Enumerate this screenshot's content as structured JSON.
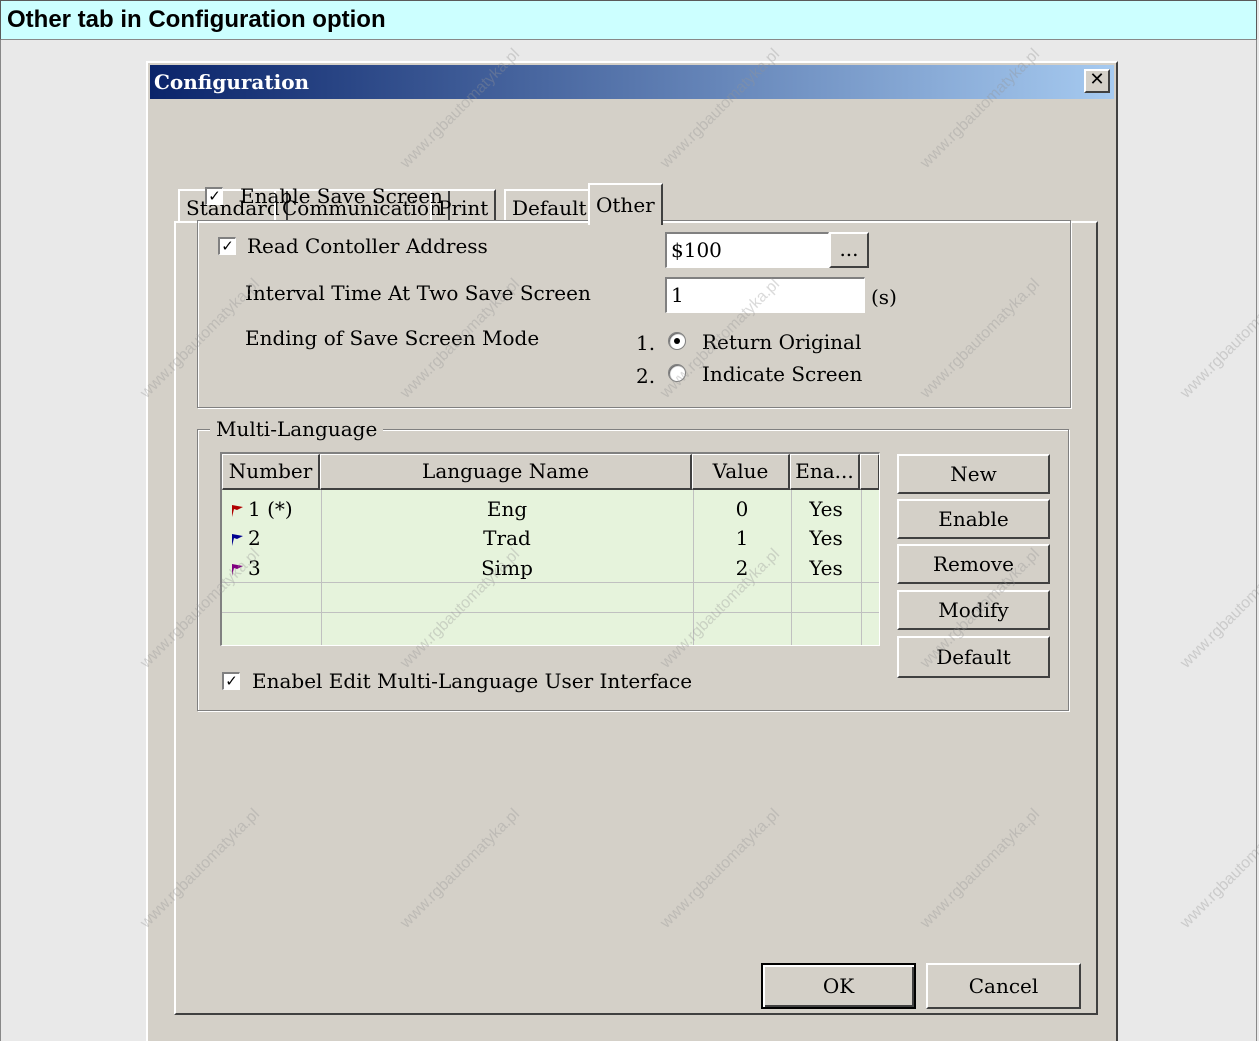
{
  "page": {
    "heading": "Other tab in Configuration option"
  },
  "dialog": {
    "title": "Configuration",
    "close_glyph": "✕",
    "tabs": [
      "Standard",
      "Communication",
      "Print",
      "Default",
      "Other"
    ],
    "active_tab": "Other",
    "enable_save_screen": {
      "label": "Enable Save Screen",
      "checked": true
    },
    "read_controller": {
      "label": "Read Contoller Address",
      "checked": true,
      "value": "$100",
      "browse_label": "..."
    },
    "interval": {
      "label": "Interval Time At Two Save Screen",
      "value": "1",
      "unit": "(s)"
    },
    "ending_mode": {
      "label": "Ending of Save Screen Mode",
      "options": [
        {
          "num": "1.",
          "label": "Return Original",
          "selected": true
        },
        {
          "num": "2.",
          "label": "Indicate Screen",
          "selected": false
        }
      ]
    },
    "multi_language": {
      "group_label": "Multi-Language",
      "columns": [
        "Number",
        "Language Name",
        "Value",
        "Ena..."
      ],
      "rows": [
        {
          "number": "1 (*)",
          "name": "Eng",
          "value": "0",
          "enabled": "Yes",
          "flag_color": "#b00000"
        },
        {
          "number": "2",
          "name": "Trad",
          "value": "1",
          "enabled": "Yes",
          "flag_color": "#000090"
        },
        {
          "number": "3",
          "name": "Simp",
          "value": "2",
          "enabled": "Yes",
          "flag_color": "#800080"
        }
      ],
      "buttons": [
        "New",
        "Enable",
        "Remove",
        "Modify",
        "Default"
      ],
      "edit_ui": {
        "label": "Enabel Edit Multi-Language User Interface",
        "checked": true
      }
    },
    "footer": {
      "ok": "OK",
      "cancel": "Cancel"
    }
  },
  "watermark": "www.rgbautomatyka.pl"
}
